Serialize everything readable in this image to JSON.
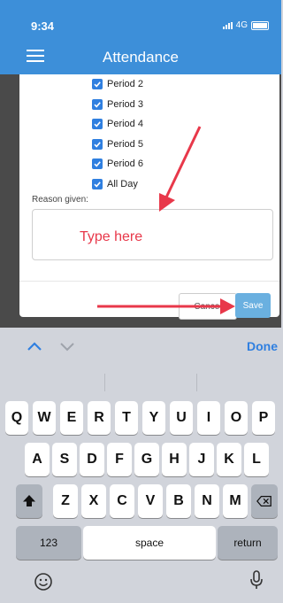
{
  "status_bar": {
    "time": "9:34",
    "network": "4G"
  },
  "header": {
    "title": "Attendance"
  },
  "checkboxes": [
    {
      "label": "Period 2",
      "checked": true
    },
    {
      "label": "Period 3",
      "checked": true
    },
    {
      "label": "Period 4",
      "checked": true
    },
    {
      "label": "Period 5",
      "checked": true
    },
    {
      "label": "Period 6",
      "checked": true
    },
    {
      "label": "All Day",
      "checked": true
    }
  ],
  "reason": {
    "label": "Reason given:",
    "overlay_text": "Type here"
  },
  "buttons": {
    "cancel": "Cancel",
    "save": "Save"
  },
  "keyboard": {
    "done": "Done",
    "row1": [
      "Q",
      "W",
      "E",
      "R",
      "T",
      "Y",
      "U",
      "I",
      "O",
      "P"
    ],
    "row2": [
      "A",
      "S",
      "D",
      "F",
      "G",
      "H",
      "J",
      "K",
      "L"
    ],
    "row3": [
      "Z",
      "X",
      "C",
      "V",
      "B",
      "N",
      "M"
    ],
    "numbers": "123",
    "space": "space",
    "return": "return"
  },
  "colors": {
    "header": "#3d8fd9",
    "accent": "#2f7fe0",
    "annotation_red": "#e8384a",
    "save": "#6ab0e0"
  },
  "icons": [
    "hamburger-icon",
    "checkmark-icon",
    "chevron-up-icon",
    "chevron-down-icon",
    "shift-icon",
    "backspace-icon",
    "emoji-icon",
    "microphone-icon"
  ]
}
